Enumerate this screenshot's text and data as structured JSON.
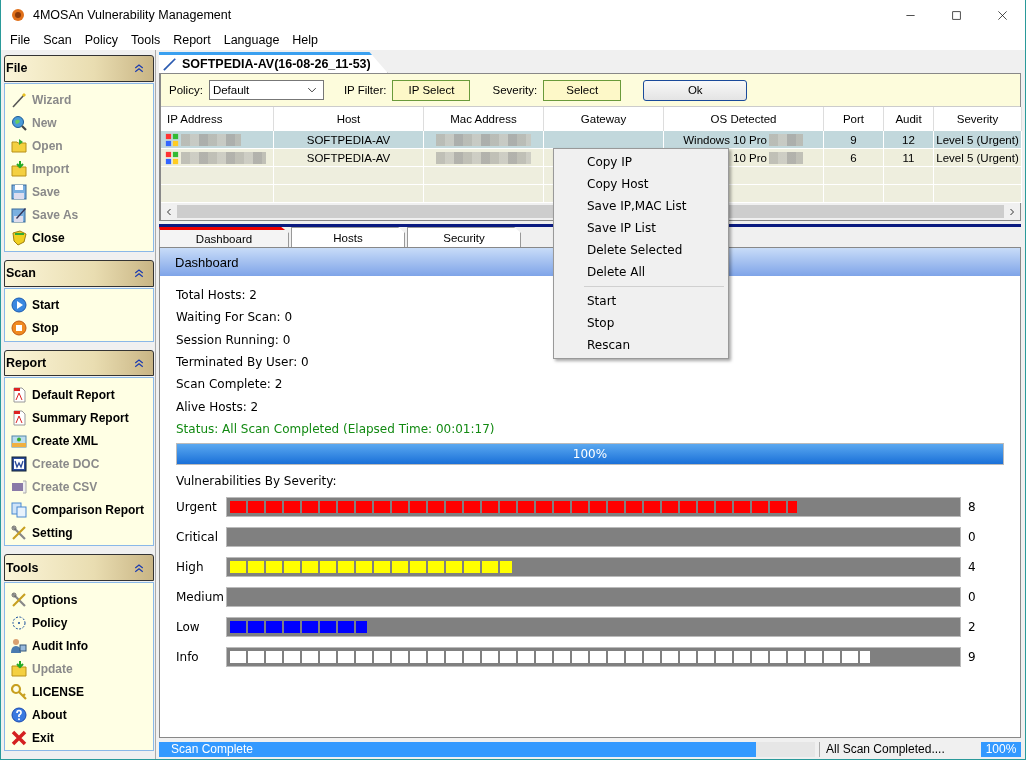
{
  "window": {
    "title": "4MOSAn Vulnerability Management"
  },
  "menu": [
    "File",
    "Scan",
    "Policy",
    "Tools",
    "Report",
    "Language",
    "Help"
  ],
  "sidebar": [
    {
      "title": "File",
      "items": [
        {
          "label": "Wizard",
          "kind": "wand",
          "disabled": true
        },
        {
          "label": "New",
          "kind": "globe",
          "disabled": true
        },
        {
          "label": "Open",
          "kind": "folder",
          "disabled": true
        },
        {
          "label": "Import",
          "kind": "import",
          "disabled": true
        },
        {
          "label": "Save",
          "kind": "disk",
          "disabled": true
        },
        {
          "label": "Save As",
          "kind": "saveas",
          "disabled": true
        },
        {
          "label": "Close",
          "kind": "shield",
          "disabled": false
        }
      ]
    },
    {
      "title": "Scan",
      "items": [
        {
          "label": "Start",
          "kind": "play",
          "disabled": false
        },
        {
          "label": "Stop",
          "kind": "stop",
          "disabled": false
        }
      ]
    },
    {
      "title": "Report",
      "items": [
        {
          "label": "Default Report",
          "kind": "pdf",
          "disabled": false
        },
        {
          "label": "Summary Report",
          "kind": "pdf",
          "disabled": false
        },
        {
          "label": "Create XML",
          "kind": "xml",
          "disabled": false
        },
        {
          "label": "Create DOC",
          "kind": "doc",
          "disabled": true
        },
        {
          "label": "Create CSV",
          "kind": "csv",
          "disabled": true
        },
        {
          "label": "Comparison Report",
          "kind": "pages",
          "disabled": false
        },
        {
          "label": "Setting",
          "kind": "tools",
          "disabled": false
        }
      ]
    },
    {
      "title": "Tools",
      "items": [
        {
          "label": "Options",
          "kind": "tools",
          "disabled": false
        },
        {
          "label": "Policy",
          "kind": "target",
          "disabled": false
        },
        {
          "label": "Audit Info",
          "kind": "user",
          "disabled": false
        },
        {
          "label": "Update",
          "kind": "import",
          "disabled": true
        },
        {
          "label": "LICENSE",
          "kind": "key",
          "disabled": false
        },
        {
          "label": "About",
          "kind": "help",
          "disabled": false
        },
        {
          "label": "Exit",
          "kind": "exit",
          "disabled": false
        }
      ]
    }
  ],
  "document_tab": {
    "title": "SOFTPEDIA-AV(16-08-26_11-53)"
  },
  "filters": {
    "policy_label": "Policy:",
    "policy_value": "Default",
    "ip_filter_label": "IP Filter:",
    "ip_filter_button": "IP Select",
    "severity_label": "Severity:",
    "severity_button": "Select",
    "ok_button": "Ok"
  },
  "table": {
    "columns": [
      "IP Address",
      "Host",
      "Mac Address",
      "Gateway",
      "OS Detected",
      "Port",
      "Audit",
      "Severity"
    ],
    "rows": [
      {
        "selected": true,
        "host": "SOFTPEDIA-AV",
        "os": "Windows 10 Pro",
        "port": "9",
        "audit": "12",
        "severity": "Level 5 (Urgent)"
      },
      {
        "selected": false,
        "host": "SOFTPEDIA-AV",
        "os": "10 Pro",
        "port": "6",
        "audit": "11",
        "severity": "Level 5 (Urgent)"
      }
    ]
  },
  "tabs": [
    {
      "label": "Dashboard",
      "selected": true
    },
    {
      "label": "Hosts",
      "selected": false
    },
    {
      "label": "Security",
      "selected": false
    }
  ],
  "dashboard": {
    "title": "Dashboard",
    "stats": [
      "Total Hosts: 2",
      "Waiting For Scan: 0",
      "Session Running: 0",
      "Terminated By User: 0",
      "Scan Complete: 2",
      "Alive Hosts: 2"
    ],
    "status": "Status: All Scan Completed (Elapsed Time: 00:01:17)",
    "progress": {
      "level": 1,
      "reading": "100%"
    },
    "severity_heading": "Vulnerabilities By Severity:",
    "severities": [
      {
        "label": "Urgent",
        "level": 0.78,
        "color": "#ff0000",
        "count": "8"
      },
      {
        "label": "Critical",
        "level": 0,
        "count": "0"
      },
      {
        "label": "High",
        "level": 0.39,
        "color": "#ffff00",
        "count": "4"
      },
      {
        "label": "Medium",
        "level": 0,
        "count": "0"
      },
      {
        "label": "Low",
        "level": 0.19,
        "color": "#0000ff",
        "count": "2"
      },
      {
        "label": "Info",
        "level": 0.88,
        "color": "#ffffff",
        "count": "9"
      }
    ]
  },
  "context_menu": {
    "groups": [
      [
        "Copy IP",
        "Copy Host",
        "Save IP,MAC List",
        "Save IP List",
        "Delete Selected",
        "Delete All"
      ],
      [
        "Start",
        "Stop",
        "Rescan"
      ]
    ]
  },
  "status_bar": {
    "progress": {
      "level": 0.91,
      "label": "Scan Complete"
    },
    "message": "All Scan Completed....",
    "percent": "100%"
  }
}
